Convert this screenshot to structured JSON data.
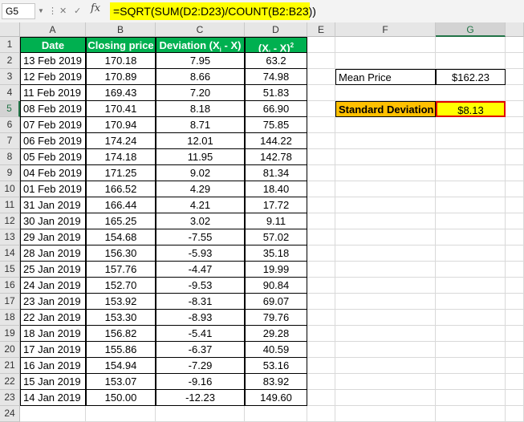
{
  "formula_bar": {
    "name_box": "G5",
    "fx_label": "fx",
    "formula": "=SQRT(SUM(D2:D23)/COUNT(B2:B23))"
  },
  "columns": [
    "A",
    "B",
    "C",
    "D",
    "E",
    "F",
    "G"
  ],
  "rows": [
    "1",
    "2",
    "3",
    "4",
    "5",
    "6",
    "7",
    "8",
    "9",
    "10",
    "11",
    "12",
    "13",
    "14",
    "15",
    "16",
    "17",
    "18",
    "19",
    "20",
    "21",
    "22",
    "23",
    "24"
  ],
  "headers": {
    "date": "Date",
    "closing": "Closing price",
    "deviation": "Deviation (Xi - X)",
    "squared": "(Xi - X)2"
  },
  "table": [
    [
      "13 Feb 2019",
      "170.18",
      "7.95",
      "63.2"
    ],
    [
      "12 Feb 2019",
      "170.89",
      "8.66",
      "74.98"
    ],
    [
      "11 Feb 2019",
      "169.43",
      "7.20",
      "51.83"
    ],
    [
      "08 Feb 2019",
      "170.41",
      "8.18",
      "66.90"
    ],
    [
      "07 Feb 2019",
      "170.94",
      "8.71",
      "75.85"
    ],
    [
      "06 Feb 2019",
      "174.24",
      "12.01",
      "144.22"
    ],
    [
      "05 Feb 2019",
      "174.18",
      "11.95",
      "142.78"
    ],
    [
      "04 Feb 2019",
      "171.25",
      "9.02",
      "81.34"
    ],
    [
      "01 Feb 2019",
      "166.52",
      "4.29",
      "18.40"
    ],
    [
      "31 Jan 2019",
      "166.44",
      "4.21",
      "17.72"
    ],
    [
      "30 Jan 2019",
      "165.25",
      "3.02",
      "9.11"
    ],
    [
      "29 Jan 2019",
      "154.68",
      "-7.55",
      "57.02"
    ],
    [
      "28 Jan 2019",
      "156.30",
      "-5.93",
      "35.18"
    ],
    [
      "25 Jan 2019",
      "157.76",
      "-4.47",
      "19.99"
    ],
    [
      "24 Jan 2019",
      "152.70",
      "-9.53",
      "90.84"
    ],
    [
      "23 Jan 2019",
      "153.92",
      "-8.31",
      "69.07"
    ],
    [
      "22 Jan 2019",
      "153.30",
      "-8.93",
      "79.76"
    ],
    [
      "18 Jan 2019",
      "156.82",
      "-5.41",
      "29.28"
    ],
    [
      "17 Jan 2019",
      "155.86",
      "-6.37",
      "40.59"
    ],
    [
      "16 Jan 2019",
      "154.94",
      "-7.29",
      "53.16"
    ],
    [
      "15 Jan 2019",
      "153.07",
      "-9.16",
      "83.92"
    ],
    [
      "14 Jan 2019",
      "150.00",
      "-12.23",
      "149.60"
    ]
  ],
  "summary": {
    "mean_label": "Mean Price",
    "mean_value": "$162.23",
    "sd_label": "Standard Deviation",
    "sd_value": "$8.13"
  },
  "colors": {
    "header_green": "#00b050",
    "highlight_yellow": "#ffff00",
    "label_orange": "#ffc000",
    "selection_red": "#e00000"
  }
}
